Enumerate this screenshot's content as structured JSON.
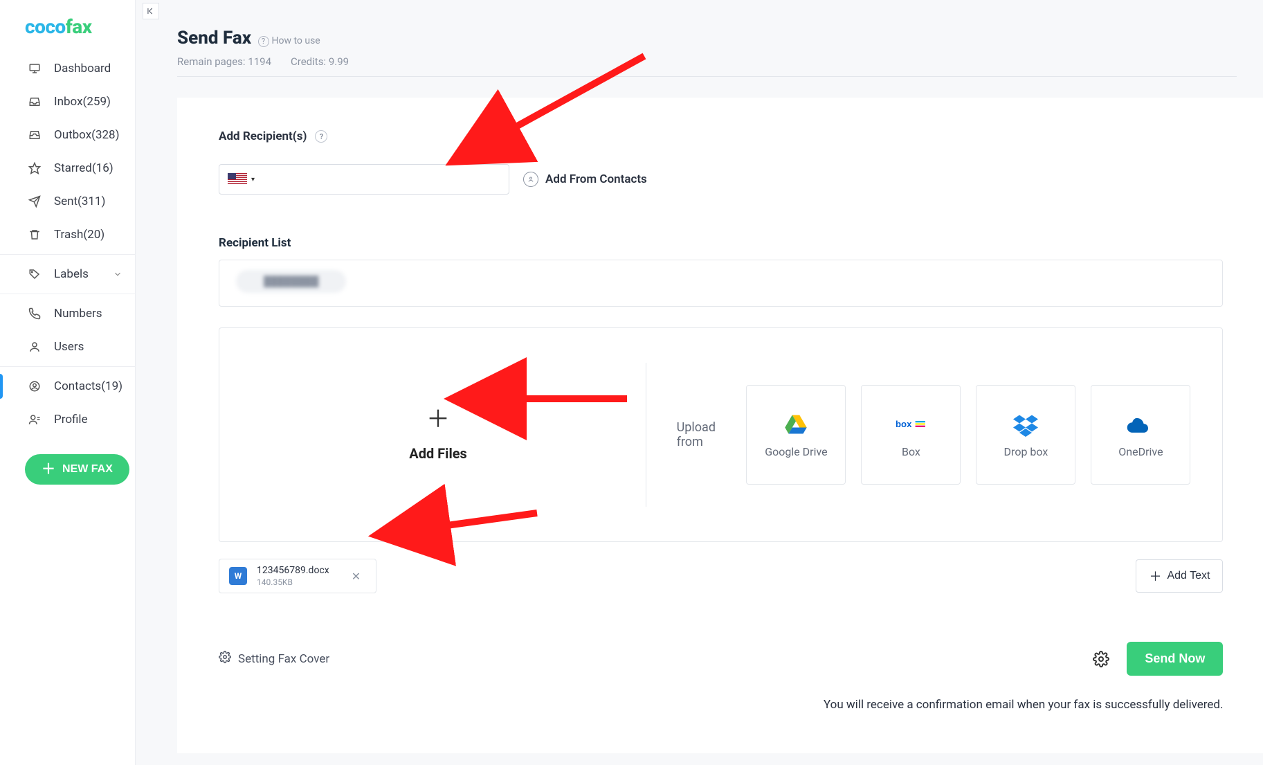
{
  "logo": {
    "part1": "coco",
    "part2": "fax"
  },
  "sidebar": {
    "dashboard": "Dashboard",
    "inbox": "Inbox(259)",
    "outbox": "Outbox(328)",
    "starred": "Starred(16)",
    "sent": "Sent(311)",
    "trash": "Trash(20)",
    "labels": "Labels",
    "numbers": "Numbers",
    "users": "Users",
    "contacts": "Contacts(19)",
    "profile": "Profile",
    "newfax": "NEW FAX"
  },
  "header": {
    "title": "Send Fax",
    "howto": "How to use",
    "remain_label": "Remain pages:",
    "remain_value": "1194",
    "credits_label": "Credits:",
    "credits_value": "9.99"
  },
  "recipients": {
    "title": "Add Recipient(s)",
    "add_from_contacts": "Add From Contacts",
    "list_title": "Recipient List",
    "placeholder_chip": "████████"
  },
  "upload": {
    "add_files": "Add Files",
    "upload_from": "Upload from",
    "providers": {
      "gdrive": "Google Drive",
      "box": "Box",
      "dropbox": "Drop box",
      "onedrive": "OneDrive"
    }
  },
  "file": {
    "name": "123456789.docx",
    "size": "140.35KB",
    "icon_letter": "W"
  },
  "add_text": "Add Text",
  "fax_cover": "Setting Fax Cover",
  "send_now": "Send Now",
  "confirm_text": "You will receive a confirmation email when your fax is successfully delivered."
}
